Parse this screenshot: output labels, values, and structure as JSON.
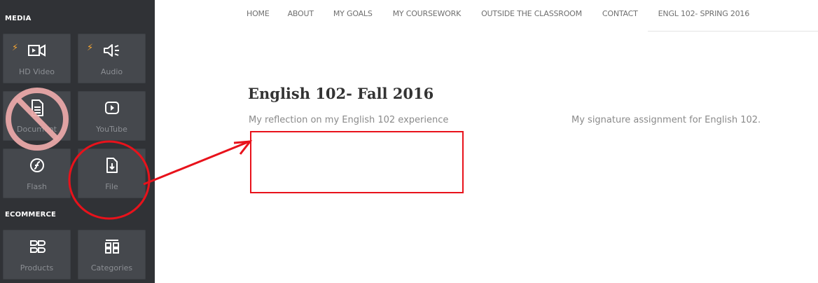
{
  "sidebar": {
    "sections": {
      "media": "MEDIA",
      "ecommerce": "ECOMMERCE"
    },
    "tiles": [
      {
        "label": "HD Video",
        "icon": "video-icon",
        "bolt": "⚡"
      },
      {
        "label": "Audio",
        "icon": "audio-icon",
        "bolt": "⚡"
      },
      {
        "label": "Document",
        "icon": "document-icon"
      },
      {
        "label": "YouTube",
        "icon": "youtube-icon"
      },
      {
        "label": "Flash",
        "icon": "flash-icon"
      },
      {
        "label": "File",
        "icon": "file-download-icon"
      },
      {
        "label": "Products",
        "icon": "products-icon"
      },
      {
        "label": "Categories",
        "icon": "categories-icon"
      }
    ]
  },
  "nav": {
    "items": [
      "HOME",
      "ABOUT",
      "MY GOALS",
      "MY COURSEWORK",
      "OUTSIDE THE CLASSROOM",
      "CONTACT",
      "ENGL 102- SPRING 2016"
    ]
  },
  "content": {
    "title": "English 102- Fall 2016",
    "left_text": "My reflection on my English 102 experience",
    "right_text": "My signature assignment for English 102."
  },
  "annotations": {
    "highlight_color": "#e8121b",
    "prohibit_color": "#e9a8a8"
  }
}
